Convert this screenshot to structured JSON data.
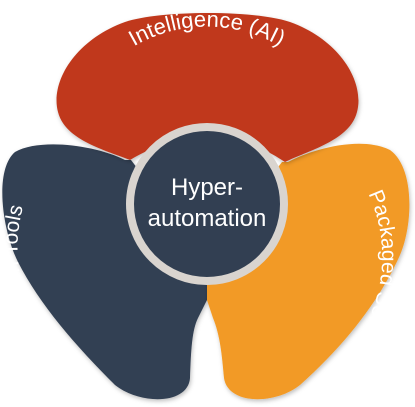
{
  "diagram": {
    "center": {
      "line1": "Hyper-",
      "line2": "automation"
    },
    "petals": {
      "top": "Intelligence (AI)",
      "right": "Packaged Software",
      "left": "Automation Tools"
    },
    "colors": {
      "top": "#c0391b",
      "right": "#f29a25",
      "left": "#323f52",
      "center": "#323f52",
      "center_ring": "#d9d4cf",
      "text": "#ffffff"
    }
  }
}
